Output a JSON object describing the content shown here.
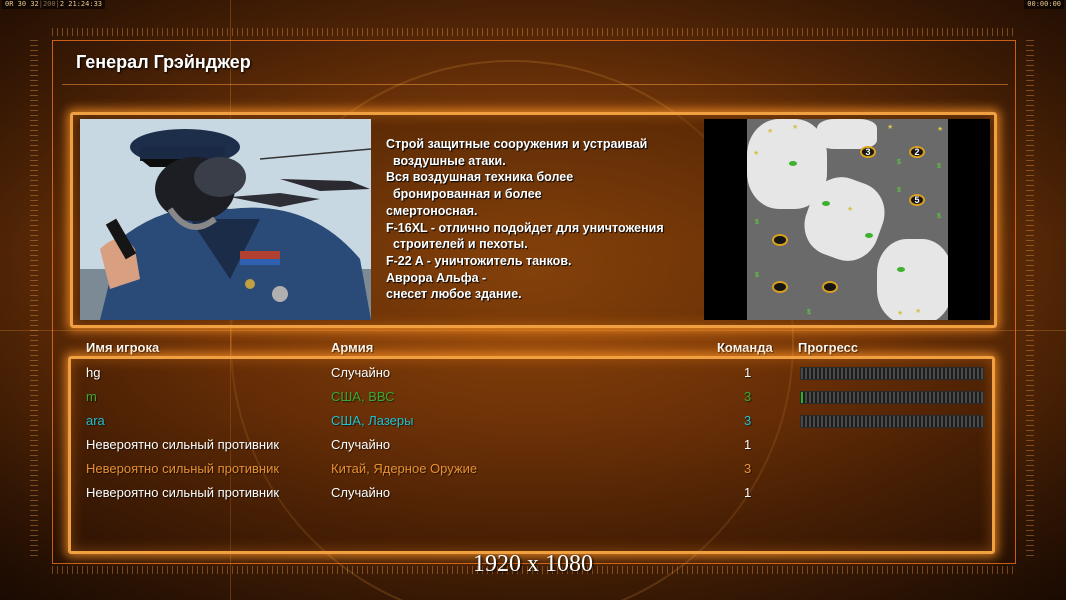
{
  "status": {
    "left_a": "0R",
    "left_b": "30",
    "left_c": "32",
    "left_d": "200",
    "left_e": "2",
    "time_left": "21:24:33",
    "time_right": "00:00:00"
  },
  "title": "Генерал Грэйнджер",
  "description": [
    "Строй защитные сооружения и устраивай",
    "  воздушные атаки.",
    "Вся воздушная техника более",
    "  бронированная и более",
    "смертоносная.",
    "F-16XL - отлично подойдет для уничтожения",
    "  строителей и пехоты.",
    "F-22 A - уничтожитель танков.",
    "Аврора Альфа -",
    "снесет любое здание."
  ],
  "map": {
    "start_positions": [
      "3",
      "2",
      "5",
      "",
      "",
      ""
    ]
  },
  "columns": {
    "name": "Имя игрока",
    "army": "Армия",
    "team": "Команда",
    "progress": "Прогресс"
  },
  "players": [
    {
      "name": "hg",
      "army": "Случайно",
      "team": "1",
      "color": "#ffffff",
      "team_color": "#ffffff",
      "progress": 0.0,
      "show_bar": true
    },
    {
      "name": "m",
      "army": "США, ВВС",
      "team": "3",
      "color": "#3aa830",
      "team_color": "#3aa830",
      "progress": 0.01,
      "show_bar": true
    },
    {
      "name": "ara",
      "army": "США, Лазеры",
      "team": "3",
      "color": "#20c0d0",
      "team_color": "#20c0d0",
      "progress": 0.0,
      "show_bar": true
    },
    {
      "name": "Невероятно сильный противник",
      "army": "Случайно",
      "team": "1",
      "color": "#ffffff",
      "team_color": "#ffffff",
      "progress": null,
      "show_bar": false
    },
    {
      "name": "Невероятно сильный противник",
      "army": "Китай, Ядерное Оружие",
      "team": "3",
      "color": "#e89030",
      "team_color": "#e89030",
      "progress": null,
      "show_bar": false
    },
    {
      "name": "Невероятно сильный противник",
      "army": "Случайно",
      "team": "1",
      "color": "#ffffff",
      "team_color": "#ffffff",
      "progress": null,
      "show_bar": false
    }
  ],
  "resolution_caption": "1920 x 1080",
  "colors": {
    "accent": "#f0a040",
    "frame": "#ff7a1e"
  }
}
